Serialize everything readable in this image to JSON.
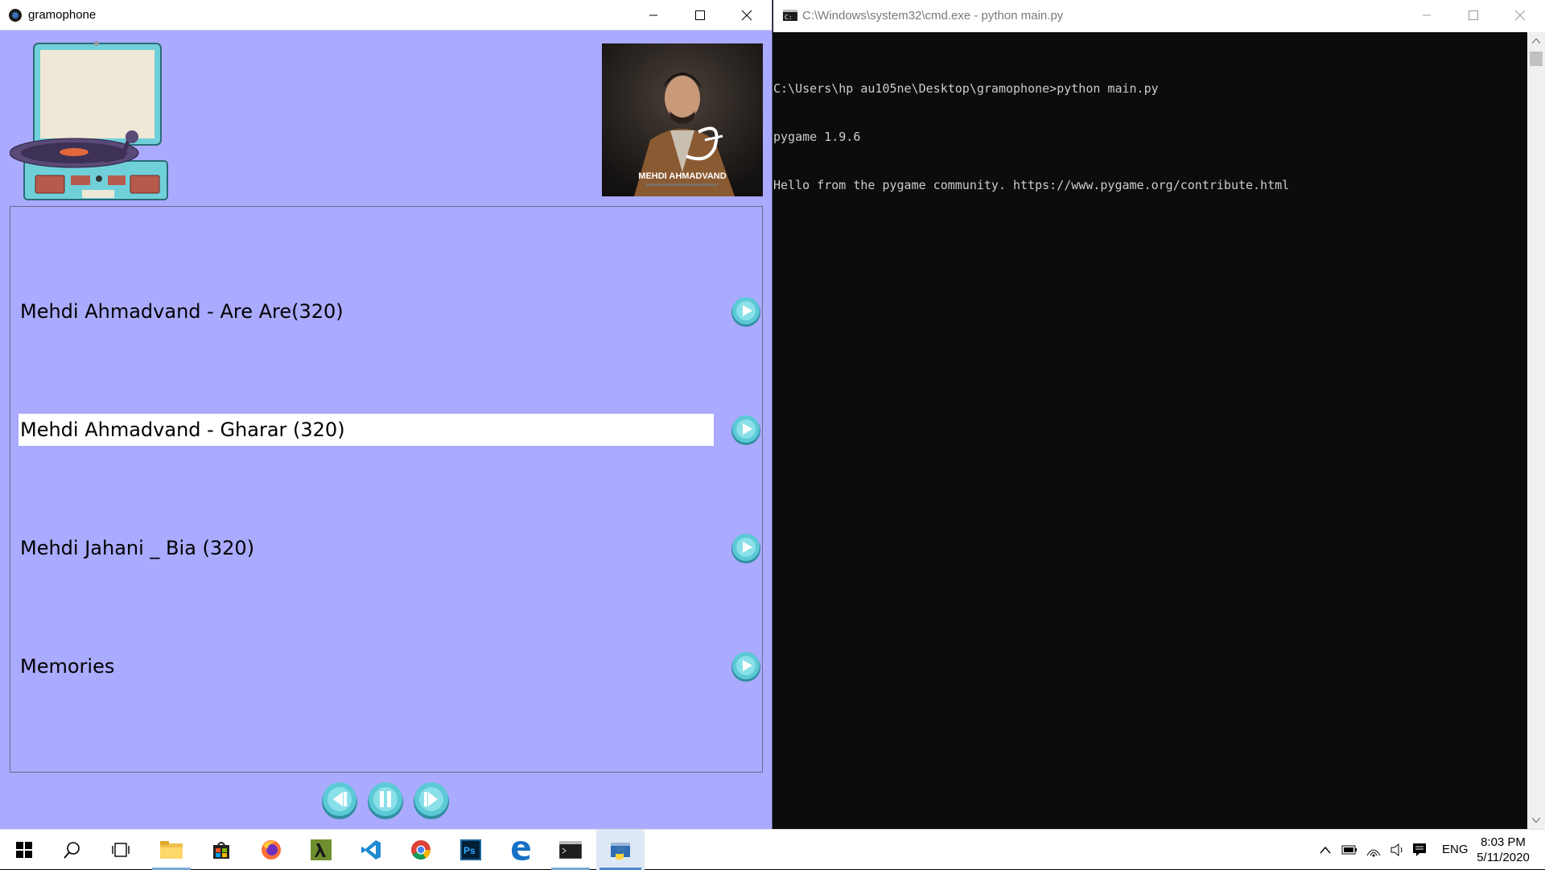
{
  "app_window": {
    "title": "gramophone",
    "playlist": [
      {
        "title": "Mehdi Ahmadvand - Are Are(320)",
        "selected": false
      },
      {
        "title": "Mehdi Ahmadvand - Gharar (320)",
        "selected": true
      },
      {
        "title": "Mehdi Jahani _ Bia (320)",
        "selected": false
      },
      {
        "title": "Memories",
        "selected": false
      }
    ],
    "album_art": {
      "artist_caption": "MEHDI AHMADVAND"
    },
    "controls": [
      "previous",
      "pause",
      "next"
    ]
  },
  "cmd_window": {
    "title": "C:\\Windows\\system32\\cmd.exe - python  main.py",
    "output_lines": [
      "C:\\Users\\hp au105ne\\Desktop\\gramophone>python main.py",
      "pygame 1.9.6",
      "Hello from the pygame community. https://www.pygame.org/contribute.html"
    ]
  },
  "taskbar": {
    "apps": [
      "start",
      "search",
      "task-view",
      "file-explorer",
      "microsoft-store",
      "firefox",
      "lambda-app",
      "vs-code",
      "chrome",
      "photoshop",
      "edge",
      "cmd",
      "python"
    ],
    "language": "ENG",
    "time": "8:03 PM",
    "date": "5/11/2020"
  },
  "colors": {
    "app_background": "#aaaaff",
    "selected_row": "#ffffff",
    "button_teal": "#5cc9d6",
    "cmd_background": "#0c0c0c"
  }
}
